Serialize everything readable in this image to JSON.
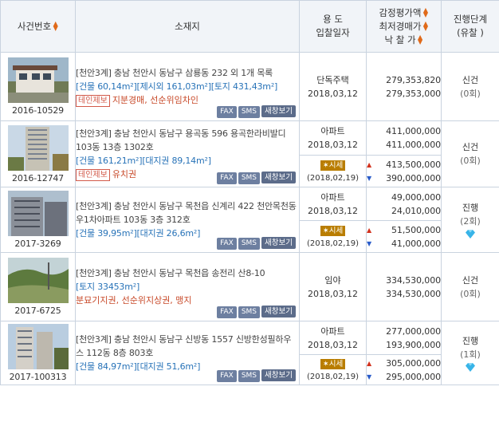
{
  "header": {
    "case_no": "사건번호",
    "location": "소재지",
    "use": "용 도",
    "bid_date": "입찰일자",
    "appraisal": "감정평가액",
    "min_bid": "최저경매가",
    "winning": "낙 찰 가",
    "status": "진행단계",
    "failed": "(유찰 )"
  },
  "buttons": {
    "fax": "FAX",
    "sms": "SMS",
    "new_window": "새창보기"
  },
  "market": {
    "label": "시세"
  },
  "rows": [
    {
      "case_no": "2016-10529",
      "address": "[천안3계] 충남 천안시 동남구 삼룡동 232 외 1개 목록",
      "area": "[건물 60,14m²][제시외 161,03m²][토지 431,43m²]",
      "tag": "테인제보",
      "notes": "지분경매, 선순위임차인",
      "use": "단독주택",
      "date": "2018,03,12",
      "appraisal": "279,353,820",
      "min_bid": "279,353,000",
      "status": "신건",
      "status_count": "(0회)"
    },
    {
      "case_no": "2016-12747",
      "address": "[천안3계] 충남 천안시 동남구 용곡동 596 용곡한라비발디 103동 13층 1302호",
      "area": "[건물 161,21m²][대지권 89,14m²]",
      "tag": "테인제보",
      "notes": "유치권",
      "use": "아파트",
      "date": "2018,03,12",
      "appraisal": "411,000,000",
      "min_bid": "411,000,000",
      "market_date": "(2018,02,19)",
      "market_high": "413,500,000",
      "market_low": "390,000,000",
      "status": "신건",
      "status_count": "(0회)"
    },
    {
      "case_no": "2017-3269",
      "address": "[천안3계] 충남 천안시 동남구 목천읍 신계리 422 천안목천동우1차아파트 103동 3층 312호",
      "area": "[건물 39,95m²][대지권 26,6m²]",
      "use": "아파트",
      "date": "2018,03,12",
      "appraisal": "49,000,000",
      "min_bid": "24,010,000",
      "market_date": "(2018,02,19)",
      "market_high": "51,500,000",
      "market_low": "41,000,000",
      "status": "진행",
      "status_count": "(2회)"
    },
    {
      "case_no": "2017-6725",
      "address": "[천안3계] 충남 천안시 동남구 목천읍 송전리 산8-10",
      "area": "[토지 33453m²]",
      "notes": "분묘기지권, 선순위지상권, 맹지",
      "use": "임야",
      "date": "2018,03,12",
      "appraisal": "334,530,000",
      "min_bid": "334,530,000",
      "status": "신건",
      "status_count": "(0회)"
    },
    {
      "case_no": "2017-100313",
      "address": "[천안3계] 충남 천안시 동남구 신방동 1557 신방한성필하우스 112동 8층 803호",
      "area": "[건물 84,97m²][대지권 51,6m²]",
      "use": "아파트",
      "date": "2018,03,12",
      "appraisal": "277,000,000",
      "min_bid": "193,900,000",
      "market_date": "(2018,02,19)",
      "market_high": "305,000,000",
      "market_low": "295,000,000",
      "status": "진행",
      "status_count": "(1회)"
    }
  ],
  "colors": {
    "area": "#2873b8",
    "notes": "#c84a2a",
    "sort": "#e06a1a",
    "market": "#b97d00",
    "gem": "#38b4e8"
  },
  "icons": [
    "sort-arrows-icon",
    "diamond-icon",
    "market-logo-icon"
  ]
}
